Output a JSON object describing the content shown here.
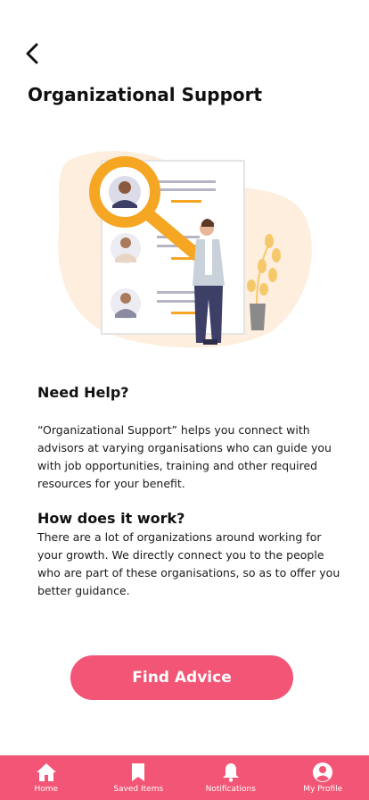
{
  "header": {
    "title": "Organizational Support"
  },
  "sections": [
    {
      "title": "Need Help?",
      "text": "“Organizational Support” helps you connect with advisors at varying organisations who can guide you with job opportunities, training and other required resources for your benefit."
    },
    {
      "title": "How does it work?",
      "text": "There are a lot of organizations around working for your growth. We directly connect you to the people who are part of these organisations, so as to offer you better guidance."
    }
  ],
  "cta": {
    "label": "Find Advice"
  },
  "tabbar": {
    "items": [
      {
        "label": "Home",
        "icon": "home-icon"
      },
      {
        "label": "Saved Items",
        "icon": "bookmark-icon"
      },
      {
        "label": "Notifications",
        "icon": "bell-icon"
      },
      {
        "label": "My Profile",
        "icon": "profile-icon"
      }
    ]
  },
  "colors": {
    "accent": "#f25575",
    "illustration_orange": "#f5a623",
    "illustration_bg": "#fdeede"
  }
}
